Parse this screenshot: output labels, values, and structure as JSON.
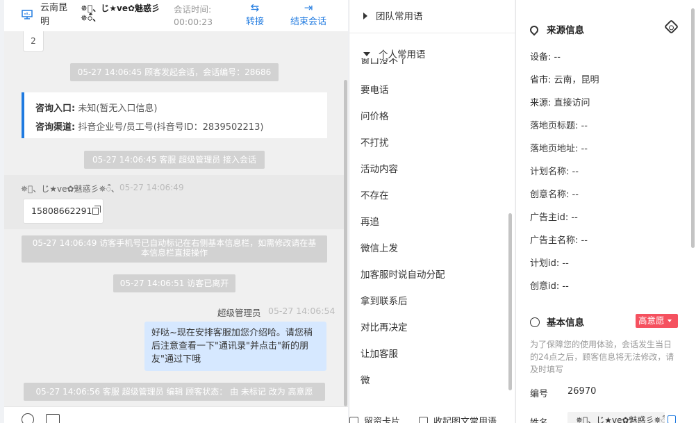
{
  "header": {
    "location": "云南昆明",
    "visitor_name": "✵ऀ、じ★ve✿魅惑彡✵ऀ、",
    "timer_label": "会话时间:",
    "timer_value": "00:00:23",
    "transfer_label": "转接",
    "end_label": "结束会话"
  },
  "chat": {
    "unread_badge": "2",
    "system_start": "05-27 14:06:45 顾客发起会话，会话编号：28686",
    "entry_key": "咨询入口:",
    "entry_value": "未知(暂无入口信息)",
    "channel_key": "咨询渠道:",
    "channel_value": "抖音企业号/员工号(抖音号ID：2839502213)",
    "system_join": "05-27 14:06:45 客服 超级管理员 接入会话",
    "visitor_name": "✵ऀ、じ★ve✿魅惑彡✵ऀ、",
    "visitor_time": "05-27 14:06:49",
    "visitor_phone": "15808662291",
    "system_phone_tag": "05-27 14:06:49 访客手机号已自动标记在右侧基本信息栏，如需修改请在基本信息栏直接操作",
    "system_left": "05-27 14:06:51 访客已离开",
    "agent_name": "超级管理员",
    "agent_time": "05-27 14:06:54",
    "agent_message": "好哒~现在安排客服加您介绍哈。请您稍后注意查看一下\"通讯录\"并点击\"新的朋友\"通过下哦",
    "system_status": "05-27 14:06:56 客服 超级管理员 编辑 顾客状态： 由 未标记 改为 高意愿"
  },
  "toolbar": {
    "emoji_icon": "smile-icon",
    "image_icon": "image-icon"
  },
  "phrases": {
    "team_group": "团队常用语",
    "personal_group": "个人常用语",
    "partial_item": "窗口没不了",
    "items": [
      "要电话",
      "问价格",
      "不打扰",
      "活动内容",
      "不存在",
      "再追",
      "微信上发",
      "加客服时说自动分配",
      "拿到联系后",
      "对比再决定",
      "让加客服",
      "微"
    ],
    "bottom_card": "留资卡片",
    "bottom_collapse": "收起图文常用语"
  },
  "source_info": {
    "title": "来源信息",
    "fields": [
      {
        "label": "设备:",
        "value": "--"
      },
      {
        "label": "省市:",
        "value": "云南，昆明"
      },
      {
        "label": "来源:",
        "value": "直接访问"
      },
      {
        "label": "落地页标题:",
        "value": "--"
      },
      {
        "label": "落地页地址:",
        "value": "--"
      },
      {
        "label": "计划名称:",
        "value": "--"
      },
      {
        "label": "创意名称:",
        "value": "--"
      },
      {
        "label": "广告主id:",
        "value": "--"
      },
      {
        "label": "广告主名称:",
        "value": "--"
      },
      {
        "label": "计划id:",
        "value": "--"
      },
      {
        "label": "创意id:",
        "value": "--"
      }
    ]
  },
  "basic_info": {
    "title": "基本信息",
    "intent_badge": "高意愿",
    "notice": "为了保障您的使用体验，会话发生当日的24点之后，顾客信息将无法修改，请及时填写",
    "id_label": "编号",
    "id_value": "26970",
    "name_label": "姓名",
    "name_value": "✵ऀ、じ★ve✿魅惑彡✵ऀ、"
  },
  "colors": {
    "accent": "#1f7ae0",
    "agent_bubble": "#d6e8ff",
    "system_pill": "#d2d2d2",
    "intent_badge": "#f5515f"
  }
}
